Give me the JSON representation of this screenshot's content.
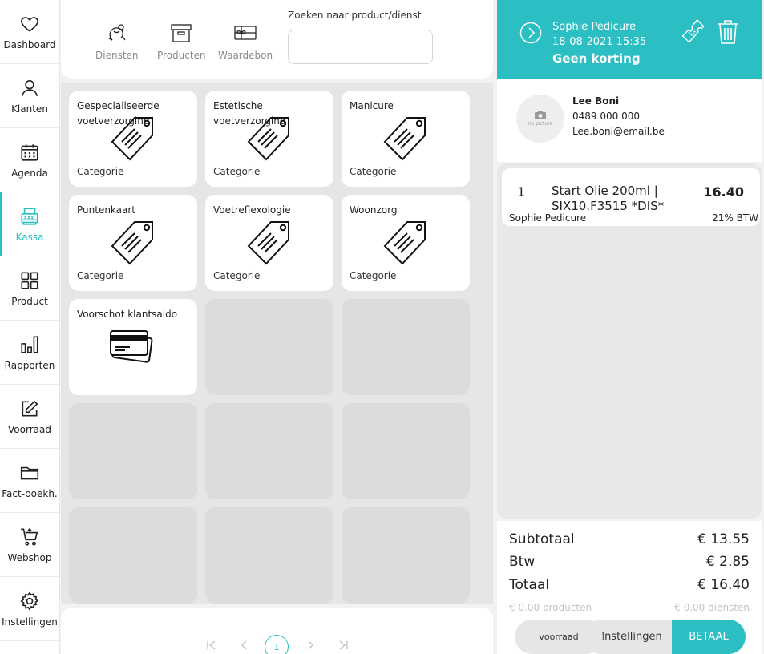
{
  "sidebar": {
    "items": [
      {
        "label": "Dashboard",
        "icon": "heart-icon"
      },
      {
        "label": "Klanten",
        "icon": "user-icon"
      },
      {
        "label": "Agenda",
        "icon": "calendar-icon"
      },
      {
        "label": "Kassa",
        "icon": "cash-register-icon",
        "active": true
      },
      {
        "label": "Product",
        "icon": "grid-icon"
      },
      {
        "label": "Rapporten",
        "icon": "bar-chart-icon"
      },
      {
        "label": "Voorraad",
        "icon": "edit-icon"
      },
      {
        "label": "Fact-boekh.",
        "icon": "folder-icon"
      },
      {
        "label": "Webshop",
        "icon": "cart-icon"
      },
      {
        "label": "Instellingen",
        "icon": "gear-icon"
      }
    ]
  },
  "toolbar": {
    "diensten": "Diensten",
    "producten": "Producten",
    "waardebon": "Waardebon",
    "search_label": "Zoeken naar product/dienst",
    "search_value": "",
    "search_placeholder": ""
  },
  "tiles": [
    {
      "title": "Gespecialiseerde voetverzorging",
      "sub": "Categorie",
      "icon": "tag-icon"
    },
    {
      "title": "Estetische voetverzorging",
      "sub": "Categorie",
      "icon": "tag-icon"
    },
    {
      "title": "Manicure",
      "sub": "Categorie",
      "icon": "tag-icon"
    },
    {
      "title": "Puntenkaart",
      "sub": "Categorie",
      "icon": "tag-icon"
    },
    {
      "title": "Voetreflexologie",
      "sub": "Categorie",
      "icon": "tag-icon"
    },
    {
      "title": "Woonzorg",
      "sub": "Categorie",
      "icon": "tag-icon"
    },
    {
      "title": "Voorschot klantsaldo",
      "sub": "",
      "icon": "credit-card-icon"
    }
  ],
  "pagination": {
    "current": "1"
  },
  "appointment": {
    "name": "Sophie Pedicure",
    "datetime": "18-08-2021 15:35",
    "discount": "Geen korting"
  },
  "customer": {
    "avatar_text": "no picture",
    "name": "Lee Boni",
    "phone": "0489 000 000",
    "email": "Lee.boni@email.be"
  },
  "cart": {
    "lines": [
      {
        "qty": "1",
        "name": "Start Olie 200ml | SIX10.F3515 *DIS*",
        "price": "16.40",
        "staff": "Sophie Pedicure",
        "vat": "21% BTW"
      }
    ]
  },
  "totals": {
    "subtotal_label": "Subtotaal",
    "subtotal": "€ 13.55",
    "btw_label": "Btw",
    "btw": "€ 2.85",
    "total_label": "Totaal",
    "total": "€ 16.40",
    "products": "€ 0.00 producten",
    "services": "€ 0.00 diensten"
  },
  "buttons": {
    "voorraad": "voorraad",
    "instellingen": "Instellingen",
    "betaal": "BETAAL"
  },
  "colors": {
    "accent": "#2bbfc4"
  }
}
